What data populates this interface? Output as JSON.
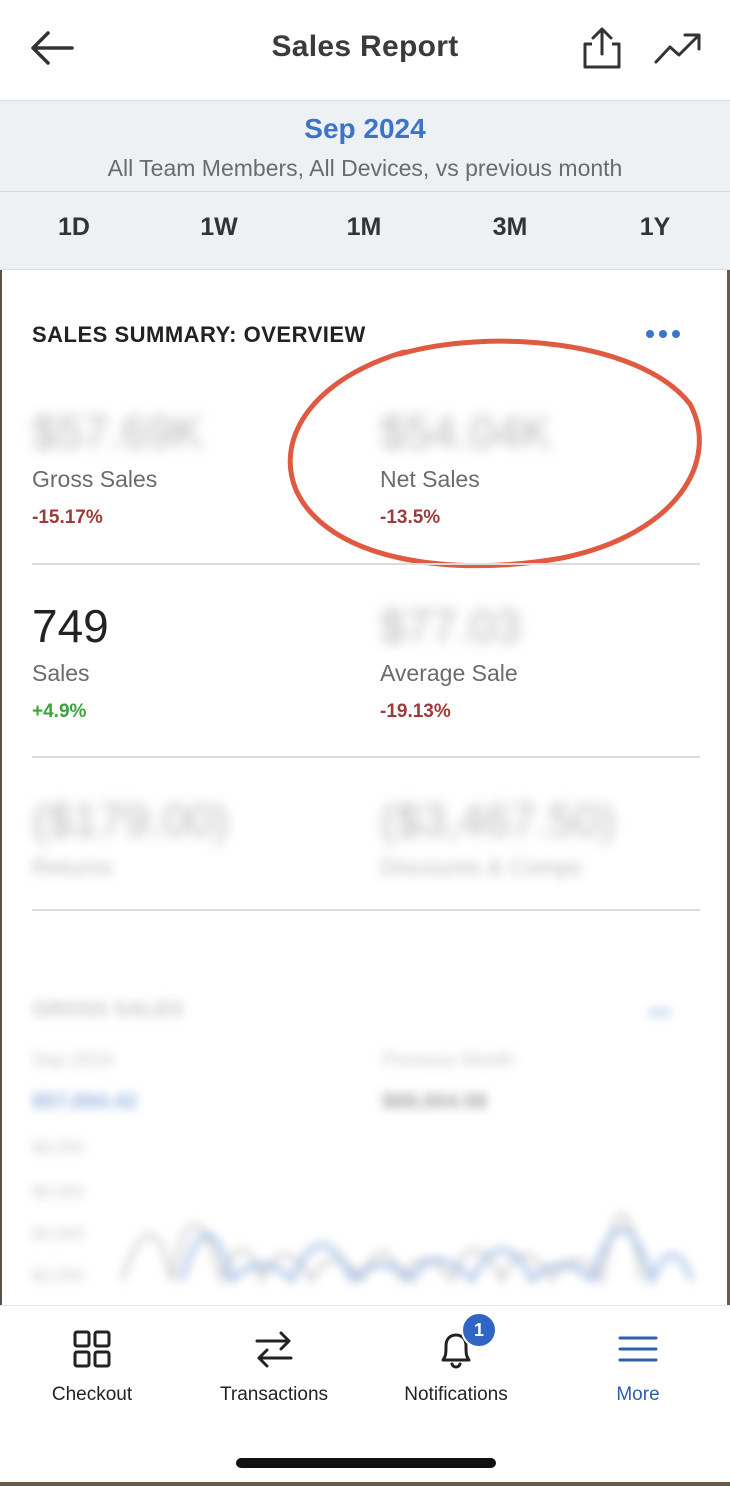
{
  "header": {
    "title": "Sales Report",
    "back_icon": "arrow-left-icon",
    "share_icon": "share-icon",
    "trend_icon": "trending-up-icon"
  },
  "filters": {
    "period": "Sep 2024",
    "description": "All Team Members, All Devices, vs previous month",
    "ranges": [
      "1D",
      "1W",
      "1M",
      "3M",
      "1Y"
    ]
  },
  "summary": {
    "title": "SALES SUMMARY: OVERVIEW",
    "metrics": [
      {
        "value": "$57.69K",
        "label": "Gross Sales",
        "change": "-15.17%"
      },
      {
        "value": "$54.04K",
        "label": "Net Sales",
        "change": "-13.5%"
      },
      {
        "value": "749",
        "label": "Sales",
        "change": "+4.9%"
      },
      {
        "value": "$77.03",
        "label": "Average Sale",
        "change": "-19.13%"
      },
      {
        "value": "($179.00)",
        "label": "Returns"
      },
      {
        "value": "($3,467.50)",
        "label": "Discounts & Comps"
      }
    ]
  },
  "gross_sales_section": {
    "heading": "GROSS SALES",
    "current_label": "Sep 2024",
    "current_amount": "$57,694.42",
    "previous_label": "Previous Month",
    "previous_amount": "$68,004.58",
    "y_ticks": [
      "$8,000",
      "$6,000",
      "$4,000",
      "$2,000"
    ]
  },
  "bottom_nav": {
    "items": [
      {
        "label": "Checkout",
        "icon": "grid-icon"
      },
      {
        "label": "Transactions",
        "icon": "swap-arrows-icon"
      },
      {
        "label": "Notifications",
        "icon": "bell-icon",
        "badge": "1"
      },
      {
        "label": "More",
        "icon": "hamburger-menu-icon",
        "active": true
      }
    ]
  },
  "colors": {
    "accent": "#3b74c9",
    "negative": "#9e3a3a",
    "positive": "#3aa43a",
    "annotation": "#e05a42"
  }
}
